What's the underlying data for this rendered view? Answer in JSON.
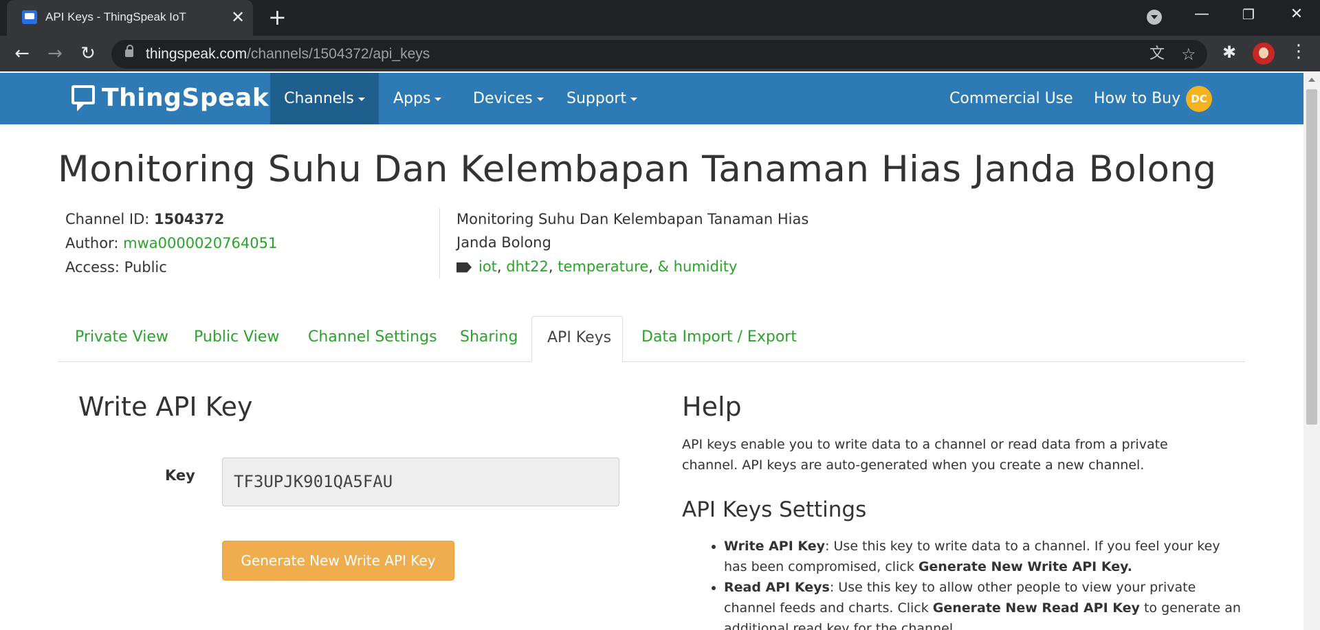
{
  "browser": {
    "tab_title": "API Keys - ThingSpeak IoT",
    "tab_close": "✕",
    "new_tab": "+",
    "url_host": "thingspeak.com",
    "url_path": "/channels/1504372/api_keys",
    "back": "←",
    "forward": "→",
    "reload": "↻",
    "star": "☆",
    "translate": "文",
    "extensions": "✱",
    "menu": "⋮",
    "minimize": "—",
    "restore": "❐",
    "close": "✕"
  },
  "navbar": {
    "brand": "ThingSpeak™",
    "items": [
      {
        "label": "Channels"
      },
      {
        "label": "Apps"
      },
      {
        "label": "Devices"
      },
      {
        "label": "Support"
      }
    ],
    "commercial_use": "Commercial Use",
    "how_to_buy": "How to Buy",
    "user_initials": "DC"
  },
  "channel": {
    "title": "Monitoring Suhu Dan Kelembapan Tanaman Hias Janda Bolong",
    "id_label": "Channel ID:",
    "id_value": "1504372",
    "author_label": "Author:",
    "author_value": "mwa0000020764051",
    "access_label": "Access:",
    "access_value": "Public",
    "description_line1": "Monitoring Suhu Dan Kelembapan Tanaman Hias",
    "description_line2": "Janda Bolong",
    "tags": [
      "iot",
      "dht22",
      "temperature",
      "& humidity"
    ],
    "tag_separators": [
      ", ",
      ", ",
      ", "
    ]
  },
  "tabs": [
    {
      "label": "Private View",
      "active": false
    },
    {
      "label": "Public View",
      "active": false
    },
    {
      "label": "Channel Settings",
      "active": false
    },
    {
      "label": "Sharing",
      "active": false
    },
    {
      "label": "API Keys",
      "active": true
    },
    {
      "label": "Data Import / Export",
      "active": false
    }
  ],
  "write_api": {
    "title": "Write API Key",
    "key_label": "Key",
    "key_value": "TF3UPJK901QA5FAU",
    "button": "Generate New Write API Key"
  },
  "help": {
    "title": "Help",
    "paragraph": "API keys enable you to write data to a channel or read data from a private channel. API keys are auto-generated when you create a new channel.",
    "settings_title": "API Keys Settings",
    "items": [
      {
        "term": "Write API Key",
        "text_before": ": Use this key to write data to a channel. If you feel your key has been compromised, click ",
        "action": "Generate New Write API Key.",
        "text_after": ""
      },
      {
        "term": "Read API Keys",
        "text_before": ": Use this key to allow other people to view your private channel feeds and charts. Click ",
        "action": "Generate New Read API Key",
        "text_after": " to generate an additional read key for the channel."
      }
    ]
  }
}
